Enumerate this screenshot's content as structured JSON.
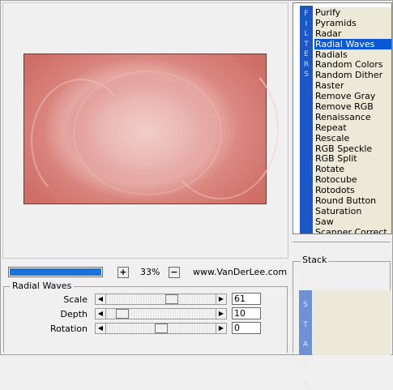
{
  "filters_tab": {
    "label": "FILTERS"
  },
  "filters": {
    "selected_index": 3,
    "items": [
      "Purify",
      "Pyramids",
      "Radar",
      "Radial Waves",
      "Radials",
      "Random Colors",
      "Random Dither",
      "Raster",
      "Remove Gray",
      "Remove RGB",
      "Renaissance",
      "Repeat",
      "Rescale",
      "RGB Speckle",
      "RGB Split",
      "Rotate",
      "Rotocube",
      "Rotodots",
      "Round Button",
      "Saturation",
      "Saw",
      "Scanner Correct"
    ]
  },
  "stack": {
    "title": "Stack",
    "tab_label": "STACK"
  },
  "preview": {
    "progress_fraction": 1.0
  },
  "zoom": {
    "plus": "+",
    "minus": "−",
    "value": "33%"
  },
  "credit": "www.VanDerLee.com",
  "group": {
    "title": "Radial Waves"
  },
  "params": [
    {
      "label": "Scale",
      "value": "61",
      "slider_fraction": 0.61
    },
    {
      "label": "Depth",
      "value": "10",
      "slider_fraction": 0.1
    },
    {
      "label": "Rotation",
      "value": "0",
      "slider_fraction": 0.5
    }
  ],
  "icons": {
    "left_arrow": "arrow-left-icon",
    "right_arrow": "arrow-right-icon"
  },
  "colors": {
    "selection": "#0a58d6",
    "tab": "#1c57c8",
    "progress": "#1a73d9"
  }
}
